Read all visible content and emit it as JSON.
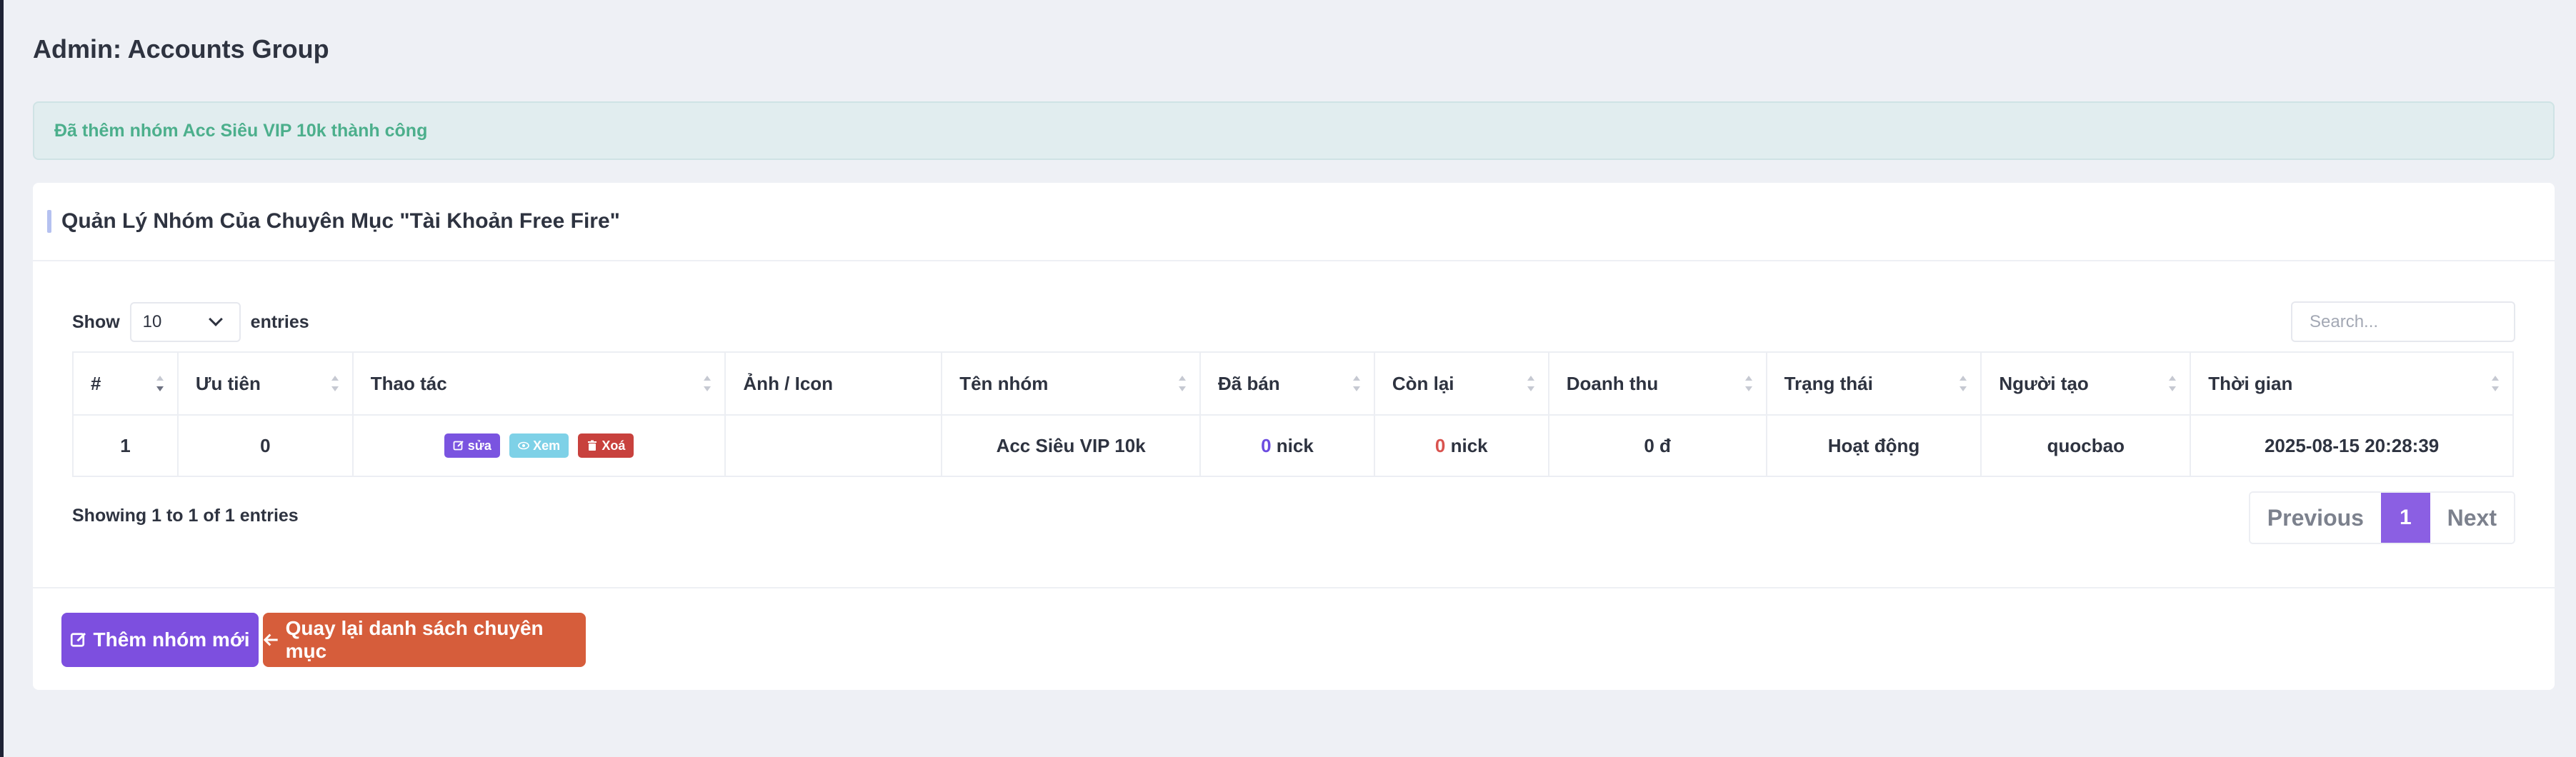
{
  "page": {
    "title": "Admin: Accounts Group"
  },
  "alert": {
    "message": "Đã thêm nhóm Acc Siêu VIP 10k thành công"
  },
  "card": {
    "title": "Quản Lý Nhóm Của Chuyên Mục \"Tài Khoản Free Fire\""
  },
  "controls": {
    "show_label": "Show",
    "page_size": "10",
    "entries_label": "entries",
    "search_placeholder": "Search..."
  },
  "table": {
    "headers": [
      "#",
      "Ưu tiên",
      "Thao tác",
      "Ảnh / Icon",
      "Tên nhóm",
      "Đã bán",
      "Còn lại",
      "Doanh thu",
      "Trạng thái",
      "Người tạo",
      "Thời gian"
    ],
    "rows": [
      {
        "index": "1",
        "priority": "0",
        "actions": {
          "edit": "sửa",
          "view": "Xem",
          "delete": "Xoá"
        },
        "icon": "",
        "group_name": "Acc Siêu VIP 10k",
        "sold_count": "0",
        "sold_unit": " nick",
        "remaining_count": "0",
        "remaining_unit": " nick",
        "revenue": "0 đ",
        "status": "Hoạt động",
        "creator": "quocbao",
        "time": "2025-08-15 20:28:39"
      }
    ]
  },
  "pagination": {
    "info": "Showing 1 to 1 of 1 entries",
    "previous": "Previous",
    "current": "1",
    "next": "Next"
  },
  "footer": {
    "add_label": "Thêm nhóm mới",
    "back_label": "Quay lại danh sách chuyên mục"
  },
  "colors": {
    "accent": "#7d4fdf",
    "danger": "#d65d3b",
    "success": "#4caf7c",
    "info": "#7ed1e7"
  },
  "icons": {
    "edit": "edit-icon",
    "view": "eye-icon",
    "delete": "trash-icon",
    "add": "edit-icon",
    "back": "arrow-left-icon",
    "dropdown": "chevron-down-icon"
  }
}
